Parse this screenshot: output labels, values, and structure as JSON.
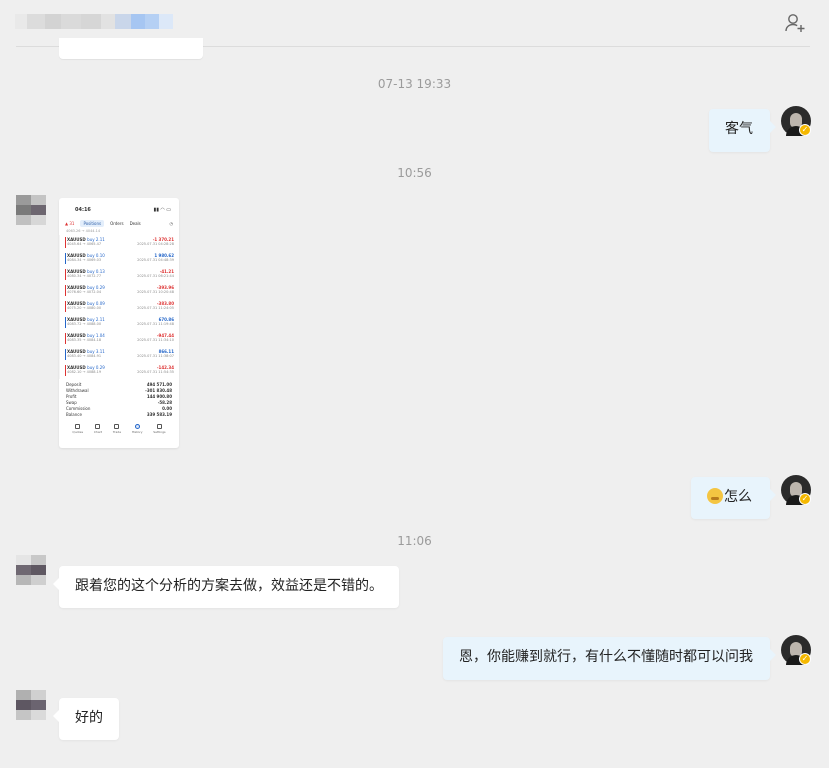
{
  "header": {
    "add_contact_icon": "add-contact-icon"
  },
  "messages": {
    "time_1": "07-13 19:33",
    "msg_1": "客气",
    "time_2": "10:56",
    "time_3": "11:06",
    "msg_2": "怎么",
    "msg_2_emoji": "thinking-face-emoji",
    "msg_3": "跟着您的这个分析的方案去做，效益还是不错的。",
    "msg_4": "恩，你能赚到就行，有什么不懂随时都可以问我",
    "msg_5": "好的"
  },
  "screenshot": {
    "status_time": "04:16",
    "tabs": [
      "Positions",
      "Orders",
      "Deals"
    ],
    "first_line": "4063.26 → 4044.14",
    "rows": [
      {
        "sym": "XAUUSD",
        "side": "buy 2.11",
        "pnl": "-1 370.21",
        "prices": "4045.64 → 4065.47",
        "date": "2025.07.31 04:28:28",
        "sign": "neg"
      },
      {
        "sym": "XAUUSD",
        "side": "buy 0.10",
        "pnl": "1 980.62",
        "prices": "4084.34 → 4069.03",
        "date": "2025.07.31 04:48:39",
        "sign": "pos"
      },
      {
        "sym": "XAUUSD",
        "side": "buy 0.13",
        "pnl": "-41.21",
        "prices": "4080.34 → 4072.77",
        "date": "2025.07.31 06:21:44",
        "sign": "neg"
      },
      {
        "sym": "XAUUSD",
        "side": "buy 0.29",
        "pnl": "-393.96",
        "prices": "4076.60 → 4072.04",
        "date": "2025.07.31 10:20:48",
        "sign": "neg"
      },
      {
        "sym": "XAUUSD",
        "side": "buy 0.09",
        "pnl": "-383.80",
        "prices": "4075.20 → 4080.00",
        "date": "2025.07.31 11:24:05",
        "sign": "neg"
      },
      {
        "sym": "XAUUSD",
        "side": "buy 2.11",
        "pnl": "670.86",
        "prices": "4083.72 → 4088.00",
        "date": "2025.07.31 11:19:48",
        "sign": "pos"
      },
      {
        "sym": "XAUUSD",
        "side": "buy 1.04",
        "pnl": "-947.44",
        "prices": "4083.35 → 4084.18",
        "date": "2025.07.31 11:34:10",
        "sign": "neg"
      },
      {
        "sym": "XAUUSD",
        "side": "buy 3.11",
        "pnl": "866.11",
        "prices": "4083.40 → 4084.91",
        "date": "2025.07.31 11:38:07",
        "sign": "pos"
      },
      {
        "sym": "XAUUSD",
        "side": "buy 0.29",
        "pnl": "-142.34",
        "prices": "4082.10 → 4088.19",
        "date": "2025.07.31 11:54:35",
        "sign": "neg"
      }
    ],
    "summary": [
      {
        "label": "Deposit",
        "value": "494 571.00"
      },
      {
        "label": "Withdrawal",
        "value": "-301 830.48"
      },
      {
        "label": "Profit",
        "value": "144 900.80"
      },
      {
        "label": "Swap",
        "value": "-58.28"
      },
      {
        "label": "Commission",
        "value": "0.00"
      },
      {
        "label": "Balance",
        "value": "339 583.19"
      }
    ],
    "nav": [
      "Quotes",
      "Chart",
      "Trade",
      "History",
      "Settings"
    ]
  },
  "colors": {
    "background": "#efefef",
    "outgoing_bubble": "#e8f4fc",
    "incoming_bubble": "#ffffff",
    "verified_badge": "#f5b800"
  }
}
